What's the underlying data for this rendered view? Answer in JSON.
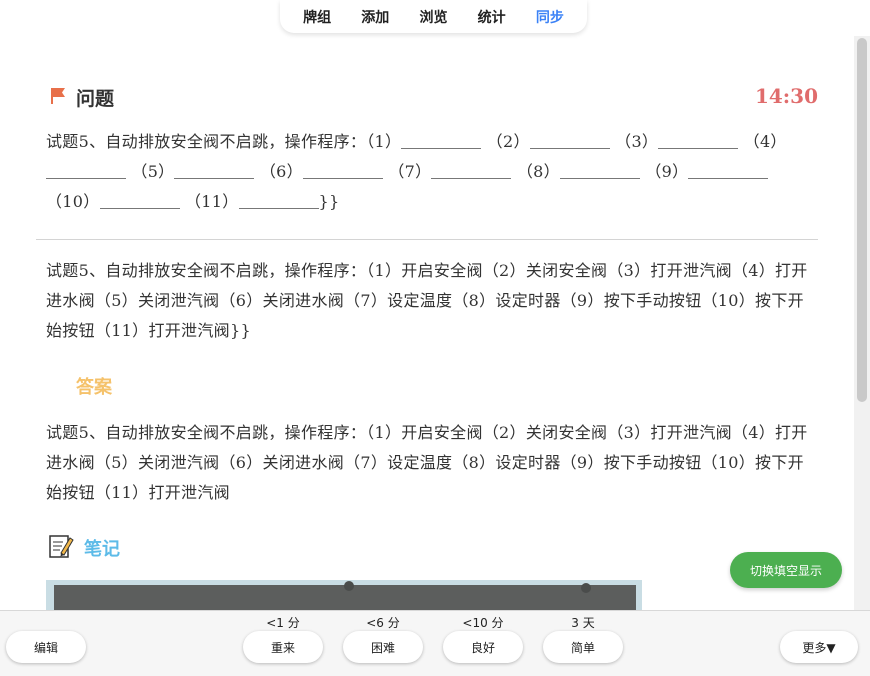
{
  "nav": {
    "tabs": [
      {
        "label": "牌组"
      },
      {
        "label": "添加"
      },
      {
        "label": "浏览"
      },
      {
        "label": "统计"
      },
      {
        "label": "同步"
      }
    ]
  },
  "question": {
    "title": "问题",
    "timer": "14:30",
    "prompt": "试题5、自动排放安全阀不启跳，操作程序：",
    "blanks": [
      "（1）",
      "（2）",
      "（3）",
      "（4）",
      "（5）",
      "（6）",
      "（7）",
      "（8）",
      "（9）",
      "（10）",
      "（11）"
    ],
    "suffix": "}}"
  },
  "full_text": "试题5、自动排放安全阀不启跳，操作程序：（1）开启安全阀（2）关闭安全阀（3）打开泄汽阀（4）打开进水阀（5）关闭泄汽阀（6）关闭进水阀（7）设定温度（8）设定时器（9）按下手动按钮（10）按下开始按钮（11）打开泄汽阀}}",
  "answer": {
    "title": "答案",
    "text": "试题5、自动排放安全阀不启跳，操作程序：（1）开启安全阀（2）关闭安全阀（3）打开泄汽阀（4）打开进水阀（5）关闭泄汽阀（6）关闭进水阀（7）设定温度（8）设定时器（9）按下手动按钮（10）按下开始按钮（11）打开泄汽阀"
  },
  "notes": {
    "title": "笔记"
  },
  "toggle_label": "切换填空显示",
  "bottom": {
    "edit_label": "编辑",
    "more_label": "更多▼",
    "answers": [
      {
        "interval": "<1 分",
        "label": "重来"
      },
      {
        "interval": "<6 分",
        "label": "困难"
      },
      {
        "interval": "<10 分",
        "label": "良好"
      },
      {
        "interval": "3 天",
        "label": "简单"
      }
    ]
  },
  "colors": {
    "active_tab": "#3b82f6",
    "timer": "#e06c6c",
    "answer_title": "#f5c26b",
    "note_title": "#5dbbe8",
    "toggle_button": "#4caf50"
  }
}
